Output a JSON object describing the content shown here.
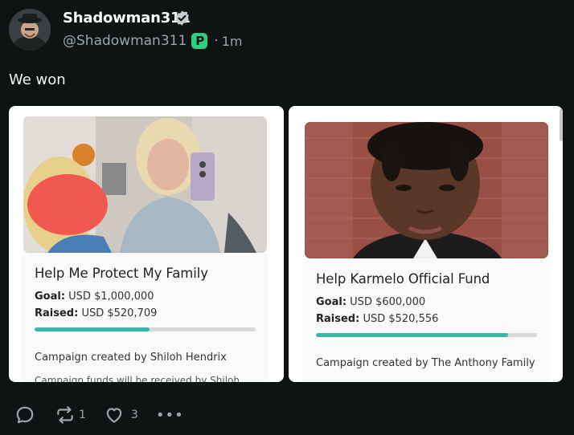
{
  "post": {
    "display_name": "Shadowman311",
    "handle": "@Shadowman311",
    "separator": "·",
    "time": "1m",
    "text": "We won",
    "platform_badge_letter": "P"
  },
  "cards": [
    {
      "title": "Help Me Protect My Family",
      "goal_label": "Goal:",
      "goal_value": "USD $1,000,000",
      "raised_label": "Raised:",
      "raised_value": "USD $520,709",
      "progress_fraction": 0.52,
      "creator": "Campaign created by Shiloh Hendrix",
      "truncated_text": "Campaign funds will be received by Shiloh"
    },
    {
      "title": "Help Karmelo Official Fund",
      "goal_label": "Goal:",
      "goal_value": "USD $600,000",
      "raised_label": "Raised:",
      "raised_value": "USD $520,556",
      "progress_fraction": 0.87,
      "creator": "Campaign created by The Anthony Family"
    }
  ],
  "actions": {
    "reply_icon": "reply-icon",
    "repost_icon": "repost-icon",
    "repost_count": "1",
    "like_icon": "heart-icon",
    "like_count": "3",
    "more_label": "•••"
  },
  "colors": {
    "background": "#0e1314",
    "muted_text": "#9aa6a8",
    "verified_badge": "#c7cdce",
    "platform_badge": "#2bd17e",
    "progress_fill": "#3bb8a5",
    "progress_track": "#d8d8dc"
  }
}
